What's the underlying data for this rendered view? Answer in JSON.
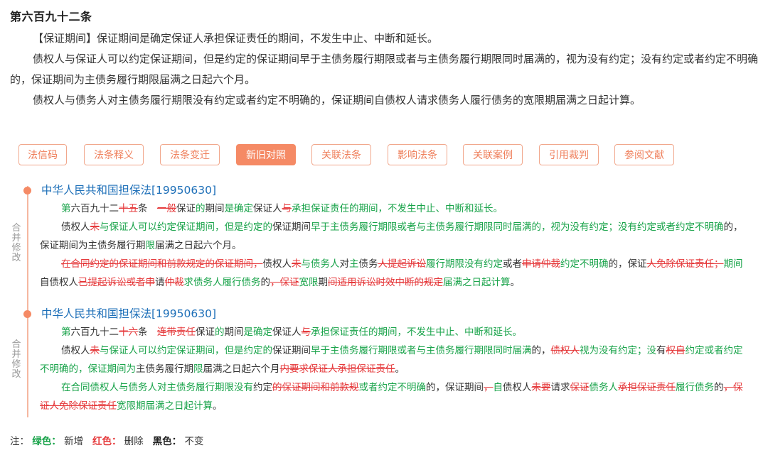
{
  "article": {
    "title": "第六百九十二条",
    "paragraphs": [
      "【保证期间】保证期间是确定保证人承担保证责任的期间，不发生中止、中断和延长。",
      "债权人与保证人可以约定保证期间，但是约定的保证期间早于主债务履行期限或者与主债务履行期限同时届满的，视为没有约定；没有约定或者约定不明确的，保证期间为主债务履行期限届满之日起六个月。",
      "债权人与债务人对主债务履行期限没有约定或者约定不明确的，保证期间自债权人请求债务人履行债务的宽限期届满之日起计算。"
    ]
  },
  "tabs": [
    {
      "label": "法信码",
      "active": false
    },
    {
      "label": "法条释义",
      "active": false
    },
    {
      "label": "法条变迁",
      "active": false
    },
    {
      "label": "新旧对照",
      "active": true
    },
    {
      "label": "关联法条",
      "active": false
    },
    {
      "label": "影响法条",
      "active": false
    },
    {
      "label": "关联案例",
      "active": false
    },
    {
      "label": "引用裁判",
      "active": false
    },
    {
      "label": "参阅文献",
      "active": false
    }
  ],
  "timeline": {
    "side_label": "合并修改",
    "entries": [
      {
        "source": "中华人民共和国担保法[19950630]",
        "paragraphs": [
          [
            [
              "g",
              "第"
            ],
            [
              "n",
              "六百九十二"
            ],
            [
              "s",
              "十五"
            ],
            [
              "n",
              "条　"
            ],
            [
              "s",
              "一般"
            ],
            [
              "n",
              "保证"
            ],
            [
              "g",
              "的"
            ],
            [
              "n",
              "期间"
            ],
            [
              "g",
              "是确定"
            ],
            [
              "n",
              "保证人"
            ],
            [
              "s",
              "与"
            ],
            [
              "g",
              "承担保证责任的期间，不发生中止、中断和延长。"
            ]
          ],
          [
            [
              "n",
              "债权人"
            ],
            [
              "s",
              "未"
            ],
            [
              "g",
              "与保证人可以约定保证期间，但是约定的"
            ],
            [
              "n",
              "保证期间"
            ],
            [
              "g",
              "早于主债务履行期限或者与主债务履行期限同时届满的，视为没有约定；没有约定或者约定不明确"
            ],
            [
              "n",
              "的，保证期间为主债务履行期"
            ],
            [
              "g",
              "限"
            ],
            [
              "n",
              "届满之日起六个月。"
            ]
          ],
          [
            [
              "s",
              "在合同约定的保证期间和前款规定的保证期间，"
            ],
            [
              "n",
              "债权人"
            ],
            [
              "s",
              "未"
            ],
            [
              "g",
              "与债务人"
            ],
            [
              "n",
              "对"
            ],
            [
              "g",
              "主"
            ],
            [
              "n",
              "债务"
            ],
            [
              "s",
              "人提起诉讼"
            ],
            [
              "g",
              "履行期限没有约定"
            ],
            [
              "n",
              "或者"
            ],
            [
              "s",
              "申请仲裁"
            ],
            [
              "g",
              "约定不明确"
            ],
            [
              "n",
              "的，保证"
            ],
            [
              "s",
              "人免除保证责任；"
            ],
            [
              "g",
              "期间"
            ],
            [
              "n",
              "自债权人"
            ],
            [
              "s",
              "已提起诉讼或者申"
            ],
            [
              "n",
              "请"
            ],
            [
              "s",
              "仲裁"
            ],
            [
              "g",
              "求债务人履行债务"
            ],
            [
              "n",
              "的"
            ],
            [
              "s",
              "，保证"
            ],
            [
              "g",
              "宽限"
            ],
            [
              "n",
              "期"
            ],
            [
              "s",
              "间适用诉讼时效中断的规定"
            ],
            [
              "g",
              "届满之日起计算"
            ],
            [
              "n",
              "。"
            ]
          ]
        ]
      },
      {
        "source": "中华人民共和国担保法[19950630]",
        "paragraphs": [
          [
            [
              "g",
              "第"
            ],
            [
              "n",
              "六百九十二"
            ],
            [
              "s",
              "十六"
            ],
            [
              "n",
              "条　"
            ],
            [
              "s",
              "连带责任"
            ],
            [
              "n",
              "保证"
            ],
            [
              "g",
              "的"
            ],
            [
              "n",
              "期间"
            ],
            [
              "g",
              "是确定"
            ],
            [
              "n",
              "保证人"
            ],
            [
              "s",
              "与"
            ],
            [
              "g",
              "承担保证责任的期间，不发生中止、中断和延长。"
            ]
          ],
          [
            [
              "n",
              "债权人"
            ],
            [
              "s",
              "未"
            ],
            [
              "g",
              "与保证人可以约定保证期间，但是约定的"
            ],
            [
              "n",
              "保证期间"
            ],
            [
              "g",
              "早于主债务履行期限或者与主债务履行期限同时届满"
            ],
            [
              "n",
              "的，"
            ],
            [
              "s",
              "债权人"
            ],
            [
              "g",
              "视为没有约定；没"
            ],
            [
              "n",
              "有"
            ],
            [
              "s",
              "权自"
            ],
            [
              "g",
              "约定或者约定不明确的，保证期间为"
            ],
            [
              "n",
              "主债务履行期"
            ],
            [
              "g",
              "限"
            ],
            [
              "n",
              "届满之日起六个月"
            ],
            [
              "s",
              "内要求保证人承担保证责任"
            ],
            [
              "n",
              "。"
            ]
          ],
          [
            [
              "g",
              "在合同债权人与债务人对主债务履行期限没有"
            ],
            [
              "n",
              "约定"
            ],
            [
              "s",
              "的保证期间和前款规"
            ],
            [
              "g",
              "或者约定不明确"
            ],
            [
              "n",
              "的，保证期间"
            ],
            [
              "s",
              "，"
            ],
            [
              "g",
              "自"
            ],
            [
              "n",
              "债权人"
            ],
            [
              "s",
              "未要"
            ],
            [
              "n",
              "请求"
            ],
            [
              "s",
              "保证"
            ],
            [
              "g",
              "债务人"
            ],
            [
              "s",
              "承担保证责任"
            ],
            [
              "g",
              "履行债务"
            ],
            [
              "n",
              "的"
            ],
            [
              "s",
              "，保证人免除保证责任"
            ],
            [
              "g",
              "宽限期届满之日起计算"
            ],
            [
              "n",
              "。"
            ]
          ]
        ]
      }
    ]
  },
  "note": {
    "prefix": "注：",
    "green_label": "绿色：",
    "green_text": "新增",
    "red_label": "红色：",
    "red_text": "删除",
    "black_label": "黑色：",
    "black_text": "不变"
  },
  "colors": {
    "accent": "#f58a65",
    "link": "#1d6fb8",
    "added": "#19a34a",
    "deleted": "#e5393b"
  }
}
